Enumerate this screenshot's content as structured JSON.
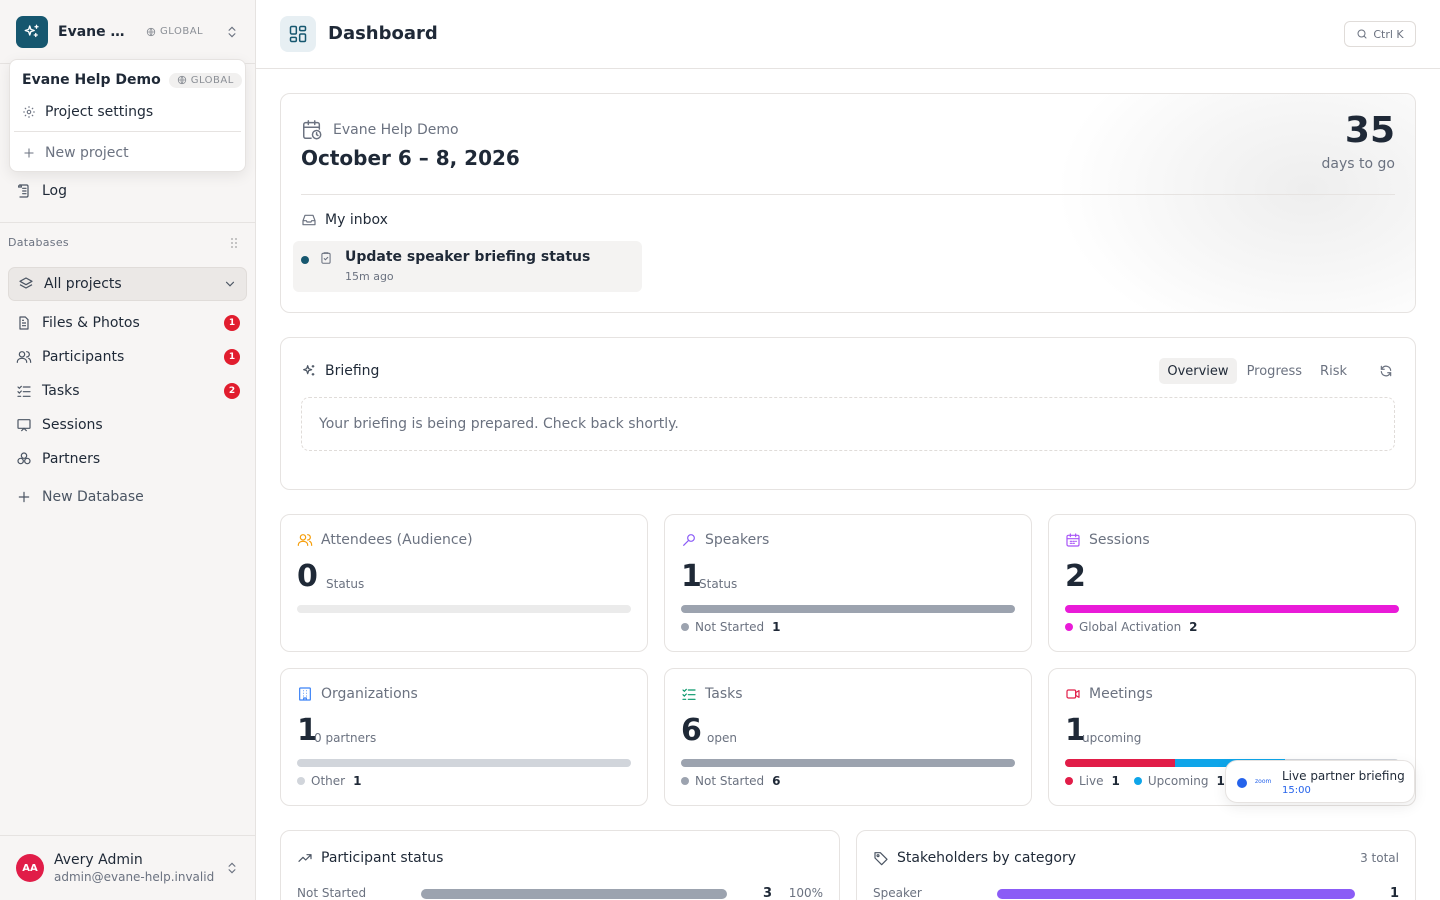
{
  "workspace": {
    "name": "Evane Help Demo",
    "scope": "GLOBAL"
  },
  "popover": {
    "title": "Evane Help Demo",
    "scope": "GLOBAL",
    "items": [
      {
        "label": "Project settings",
        "icon": "gear-icon"
      },
      {
        "label": "New project",
        "icon": "plus-icon"
      }
    ]
  },
  "sidebar": {
    "log_label": "Log",
    "databases_label": "Databases",
    "all_projects": "All projects",
    "items": [
      {
        "label": "Files & Photos",
        "badge": "1",
        "icon": "file-icon"
      },
      {
        "label": "Participants",
        "badge": "1",
        "icon": "users-icon"
      },
      {
        "label": "Tasks",
        "badge": "2",
        "icon": "checklist-icon"
      },
      {
        "label": "Sessions",
        "badge": "",
        "icon": "presentation-icon"
      },
      {
        "label": "Partners",
        "badge": "",
        "icon": "partners-icon"
      }
    ],
    "new_database": "New Database"
  },
  "user": {
    "initials": "AA",
    "name": "Avery Admin",
    "email": "admin@evane-help.invalid"
  },
  "header": {
    "title": "Dashboard",
    "search_shortcut": "Ctrl K"
  },
  "hero": {
    "project": "Evane Help Demo",
    "date_range": "October 6 – 8, 2026",
    "days_count": "35",
    "days_label": "days to go",
    "inbox_title": "My inbox",
    "inbox_item": {
      "title": "Update speaker briefing status",
      "time": "15m ago"
    }
  },
  "briefing": {
    "title": "Briefing",
    "tabs": [
      "Overview",
      "Progress",
      "Risk"
    ],
    "active_tab": "Overview",
    "message": "Your briefing is being prepared. Check back shortly."
  },
  "stats": {
    "attendees": {
      "title": "Attendees (Audience)",
      "count": "0",
      "sub": "Status",
      "color": "#f59e0b",
      "progress": []
    },
    "speakers": {
      "title": "Speakers",
      "count": "1",
      "sub": "Status",
      "color": "#8b5cf6",
      "progress": [
        {
          "label": "Not Started",
          "value": "1",
          "fraction": 1.0,
          "color": "#9ca3af"
        }
      ]
    },
    "sessions": {
      "title": "Sessions",
      "count": "2",
      "sub": "",
      "color": "#a855f7",
      "progress": [
        {
          "label": "Global Activation",
          "value": "2",
          "fraction": 1.0,
          "color": "#e91bd8"
        }
      ]
    },
    "organizations": {
      "title": "Organizations",
      "count": "1",
      "sub": "0 partners",
      "color": "#3b82f6",
      "progress": [
        {
          "label": "Other",
          "value": "1",
          "fraction": 1.0,
          "color": "#d1d5db"
        }
      ]
    },
    "tasks": {
      "title": "Tasks",
      "count": "6",
      "sub": "open",
      "color": "#059669",
      "progress": [
        {
          "label": "Not Started",
          "value": "6",
          "fraction": 1.0,
          "color": "#9ca3af"
        }
      ]
    },
    "meetings": {
      "title": "Meetings",
      "count": "1",
      "sub": "upcoming",
      "color": "#e11d48",
      "progress": [
        {
          "label": "Live",
          "value": "1",
          "fraction": 0.33,
          "color": "#e11d48"
        },
        {
          "label": "Upcoming",
          "value": "1",
          "fraction": 0.33,
          "color": "#0ea5e9"
        },
        {
          "label": "",
          "value": "",
          "fraction": 0.34,
          "color": "#d1d5db"
        }
      ]
    }
  },
  "toast": {
    "title": "Live partner briefing",
    "time": "15:00",
    "brand": "zoom"
  },
  "participant_status": {
    "title": "Participant status",
    "rows": [
      {
        "label": "Not Started",
        "value": "3",
        "pct": "100%",
        "fraction": 1.0,
        "color": "#9ca3af"
      }
    ]
  },
  "stakeholders": {
    "title": "Stakeholders by category",
    "total": "3 total",
    "rows": [
      {
        "label": "Speaker",
        "value": "1",
        "fraction": 1.0,
        "color": "#8b5cf6"
      }
    ]
  }
}
